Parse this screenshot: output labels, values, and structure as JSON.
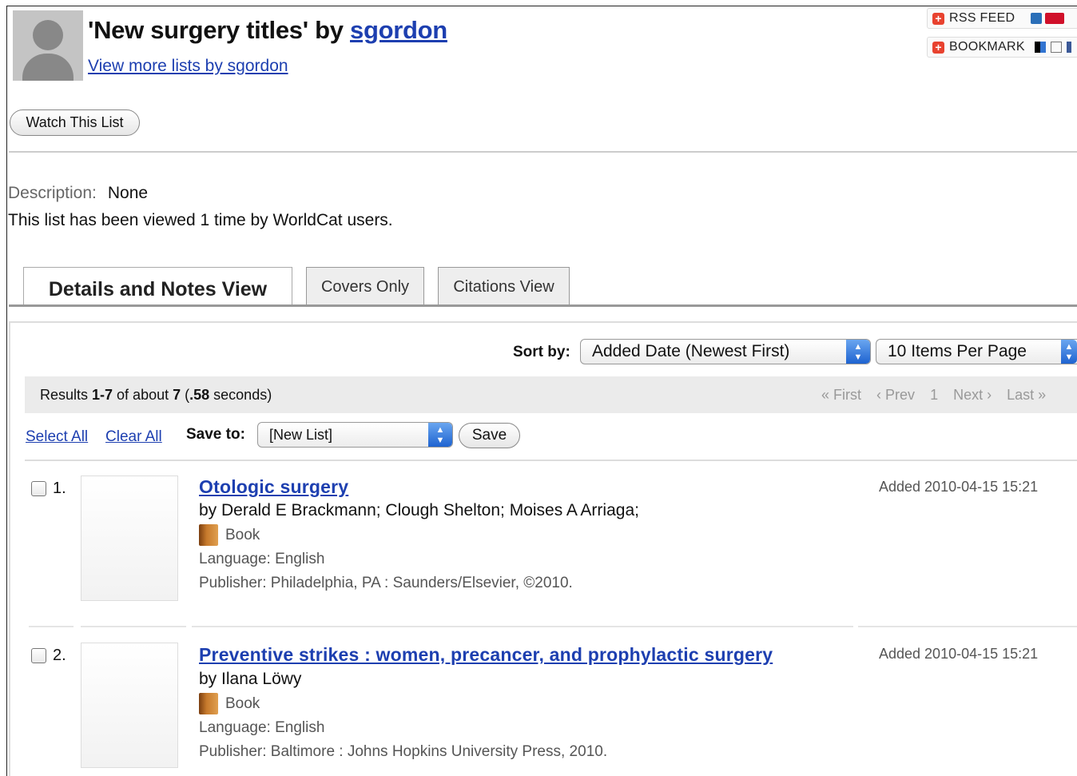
{
  "header": {
    "title_prefix": "'New surgery titles' by ",
    "owner": "sgordon",
    "more_lists": "View more lists by sgordon"
  },
  "share": {
    "rss_label": "RSS FEED",
    "bookmark_label": "BOOKMARK"
  },
  "watch_button": "Watch This List",
  "description": {
    "label": "Description:",
    "value": "None",
    "views_text": "This list has been viewed 1 time by WorldCat users."
  },
  "tabs": [
    {
      "label": "Details and Notes View",
      "active": true
    },
    {
      "label": "Covers Only",
      "active": false
    },
    {
      "label": "Citations View",
      "active": false
    }
  ],
  "sort": {
    "label": "Sort by:",
    "selected": "Added Date (Newest First)",
    "per_page": "10 Items Per Page"
  },
  "results": {
    "prefix": "Results ",
    "range": "1-7",
    "mid": " of about ",
    "total": "7",
    "time_open": " (",
    "time": ".58",
    "time_close": " seconds)"
  },
  "pager": {
    "first": "« First",
    "prev": "‹ Prev",
    "page": "1",
    "next": "Next ›",
    "last": "Last »"
  },
  "actions": {
    "select_all": "Select All",
    "clear_all": "Clear All",
    "save_to_label": "Save to:",
    "save_to_value": "[New List]",
    "save_button": "Save"
  },
  "items": [
    {
      "number": "1.",
      "title": "Otologic surgery",
      "authors": "by Derald E Brackmann; Clough Shelton; Moises A Arriaga;",
      "type": "Book",
      "language": "Language: English",
      "publisher": "Publisher: Philadelphia, PA : Saunders/Elsevier, ©2010.",
      "added": "Added 2010-04-15 15:21"
    },
    {
      "number": "2.",
      "title": "Preventive strikes : women, precancer, and prophylactic surgery",
      "authors": "by Ilana Löwy",
      "type": "Book",
      "language": "Language: English",
      "publisher": "Publisher: Baltimore : Johns Hopkins University Press, 2010.",
      "added": "Added 2010-04-15 15:21"
    }
  ]
}
